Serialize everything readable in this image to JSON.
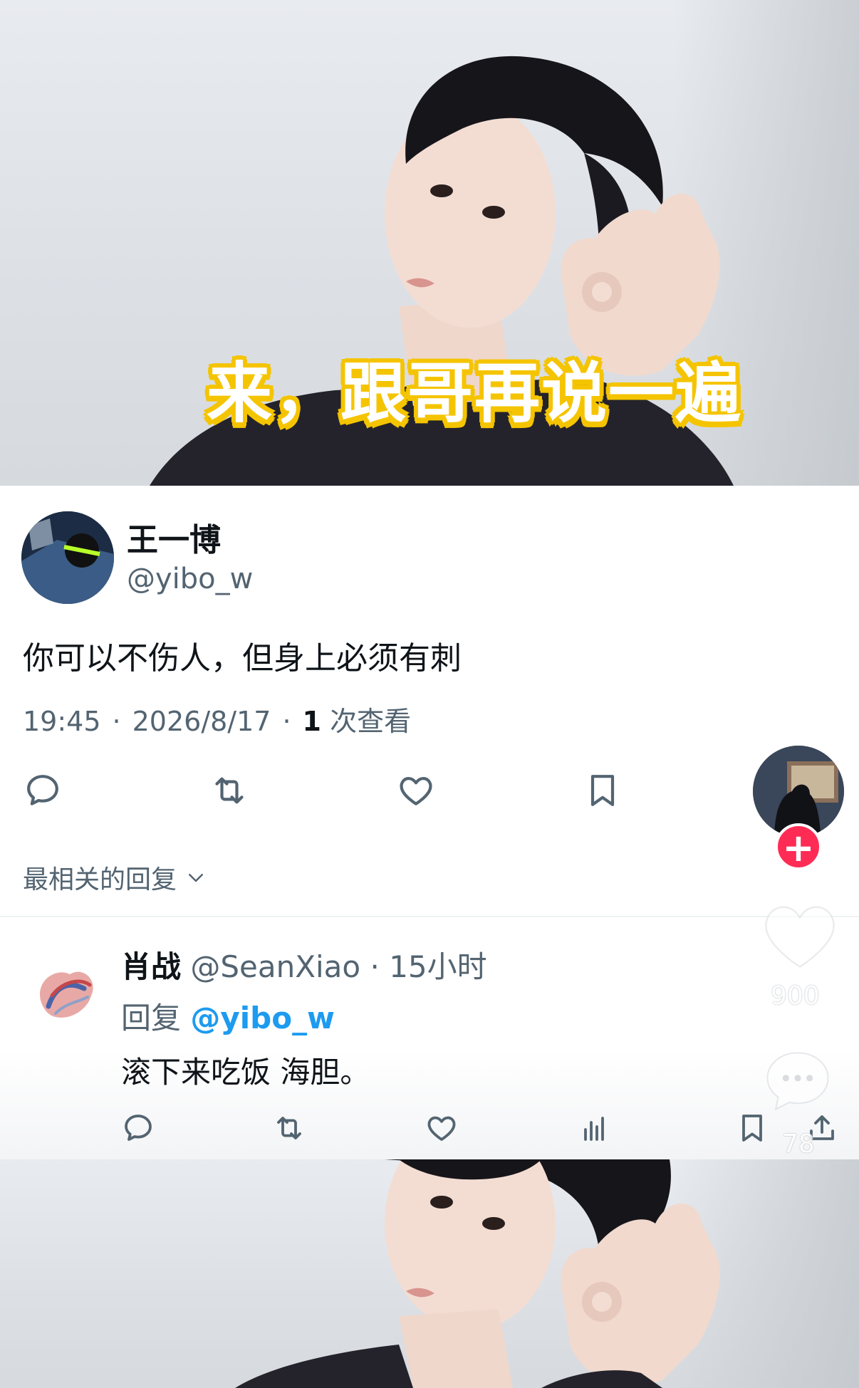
{
  "banner": {
    "caption": "来，跟哥再说一遍"
  },
  "tweet": {
    "author_name": "王一博",
    "author_handle": "@yibo_w",
    "text": "你可以不伤人，但身上必须有刺",
    "time": "19:45",
    "date": "2026/8/17",
    "views_count": "1",
    "views_label": "次查看",
    "sort_label": "最相关的回复"
  },
  "reply": {
    "author_name": "肖战",
    "author_handle": "@SeanXiao",
    "time_ago": "15小时",
    "reply_prefix": "回复",
    "reply_mention": "@yibo_w",
    "text": "滚下来吃饭 海胆。"
  },
  "overlay": {
    "like_count": "900",
    "comment_count": "78"
  },
  "icons": {
    "reply": "reply-icon",
    "retweet": "retweet-icon",
    "like": "heart-icon",
    "bookmark": "bookmark-icon",
    "views": "views-chart-icon",
    "share": "share-icon",
    "chevron": "chevron-down-icon",
    "plus": "plus-icon"
  },
  "colors": {
    "caption_stroke": "#f5c400",
    "mention": "#1d9bf0",
    "follow_button": "#fe2c55",
    "secondary_text": "#536471"
  }
}
